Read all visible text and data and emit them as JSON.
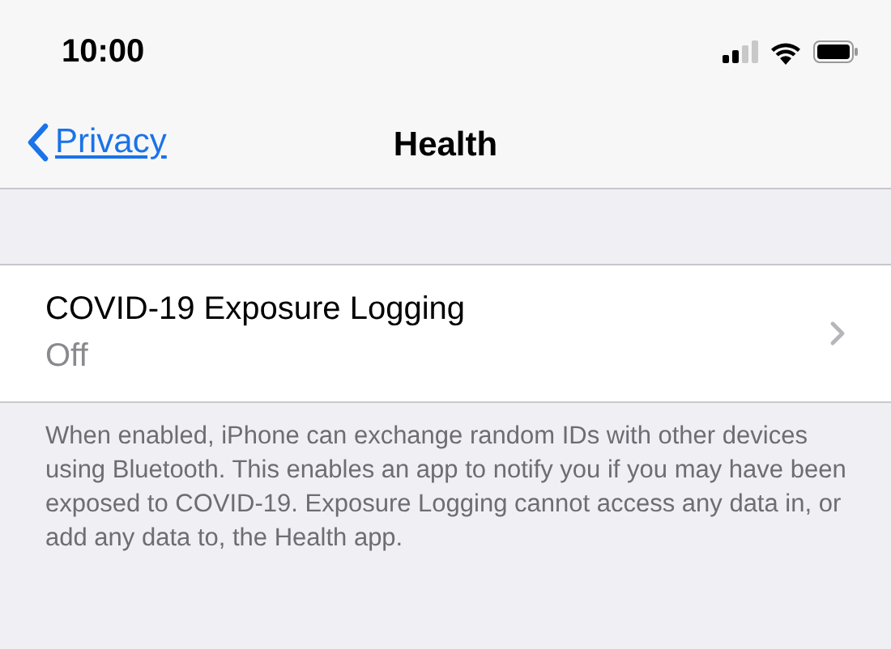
{
  "status_bar": {
    "time": "10:00"
  },
  "nav_bar": {
    "back": "Privacy",
    "title": "Health"
  },
  "cells": [
    {
      "title": "COVID-19 Exposure Logging",
      "value": "Off",
      "kind": "disclosure"
    }
  ],
  "footer": "When enabled, iPhone can exchange random IDs with other devices using Bluetooth. This enables an app to notify you if you may have been exposed to COVID-19. Exposure Logging cannot access any data in, or add any data to, the Health app."
}
